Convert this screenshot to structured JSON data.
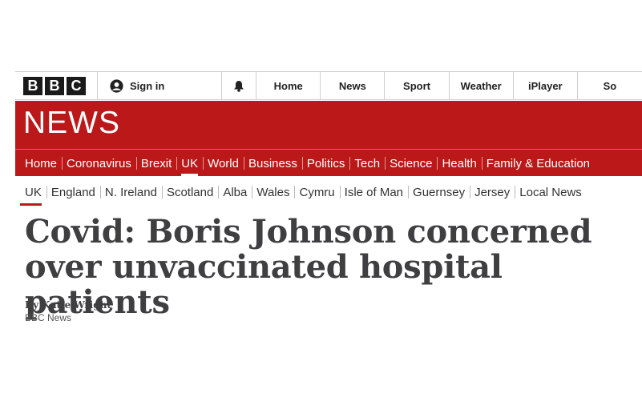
{
  "masthead": {
    "logo_letters": [
      "B",
      "B",
      "C"
    ],
    "signin_label": "Sign in",
    "nav": [
      "Home",
      "News",
      "Sport",
      "Weather",
      "iPlayer",
      "So"
    ]
  },
  "section_title": "NEWS",
  "main_nav": {
    "items": [
      "Home",
      "Coronavirus",
      "Brexit",
      "UK",
      "World",
      "Business",
      "Politics",
      "Tech",
      "Science",
      "Health",
      "Family & Education"
    ],
    "active": "UK"
  },
  "sub_nav": {
    "items": [
      "UK",
      "England",
      "N. Ireland",
      "Scotland",
      "Alba",
      "Wales",
      "Cymru",
      "Isle of Man",
      "Guernsey",
      "Jersey",
      "Local News"
    ],
    "active": "UK"
  },
  "article": {
    "headline": "Covid: Boris Johnson concerned over unvaccinated hospital patients",
    "author": "By Katie Wright",
    "source": "BBC News"
  },
  "colors": {
    "brand_red": "#bb1919",
    "text_dark": "#3f3f42"
  },
  "icons": [
    "user-icon",
    "bell-icon"
  ]
}
